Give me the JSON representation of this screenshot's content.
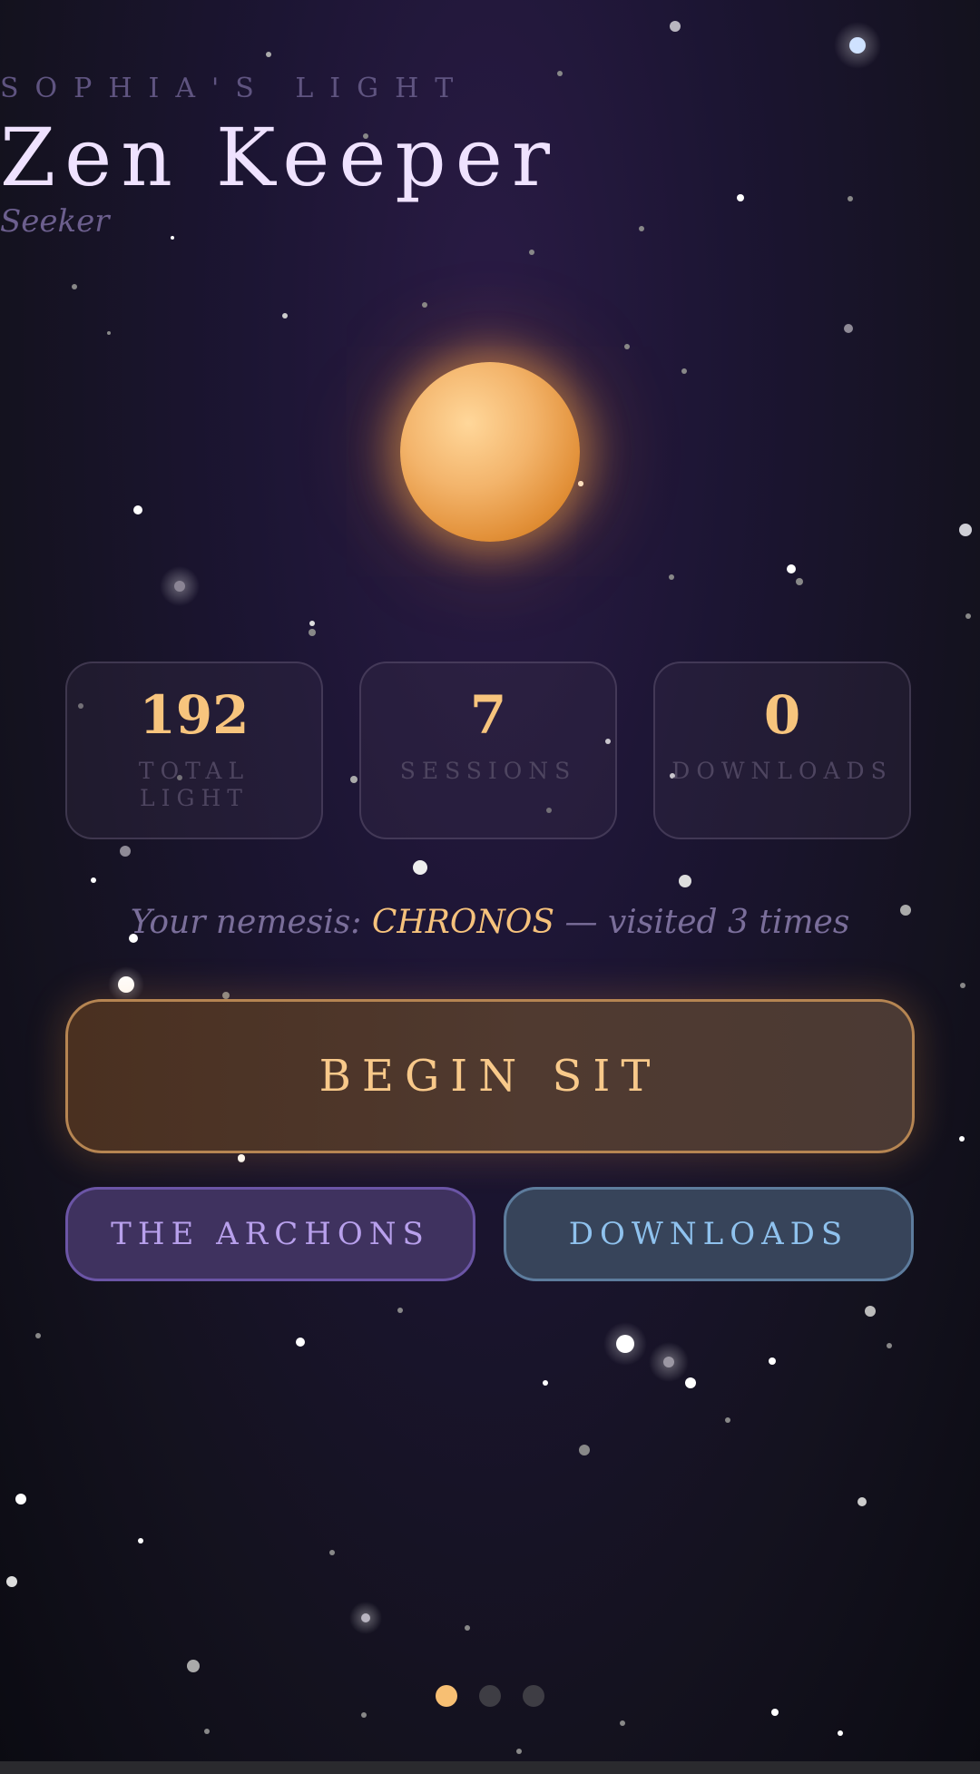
{
  "header": {
    "brand": "SOPHIA'S LIGHT",
    "title": "Zen Keeper",
    "rank": "Seeker"
  },
  "stats": [
    {
      "value": "192",
      "label": "TOTAL LIGHT"
    },
    {
      "value": "7",
      "label": "SESSIONS"
    },
    {
      "value": "0",
      "label": "DOWNLOADS"
    }
  ],
  "nemesis": {
    "prefix": "Your nemesis: ",
    "name": "CHRONOS",
    "suffix": " — visited 3 times"
  },
  "buttons": {
    "begin": "BEGIN SIT",
    "archons": "THE ARCHONS",
    "downloads": "DOWNLOADS"
  },
  "pager": {
    "pages": 3,
    "active": 1
  },
  "colors": {
    "accent": "#f7c47d",
    "orb": "#f3b46b",
    "archons": "#b8a0ec",
    "downloads": "#8fc2ee"
  }
}
